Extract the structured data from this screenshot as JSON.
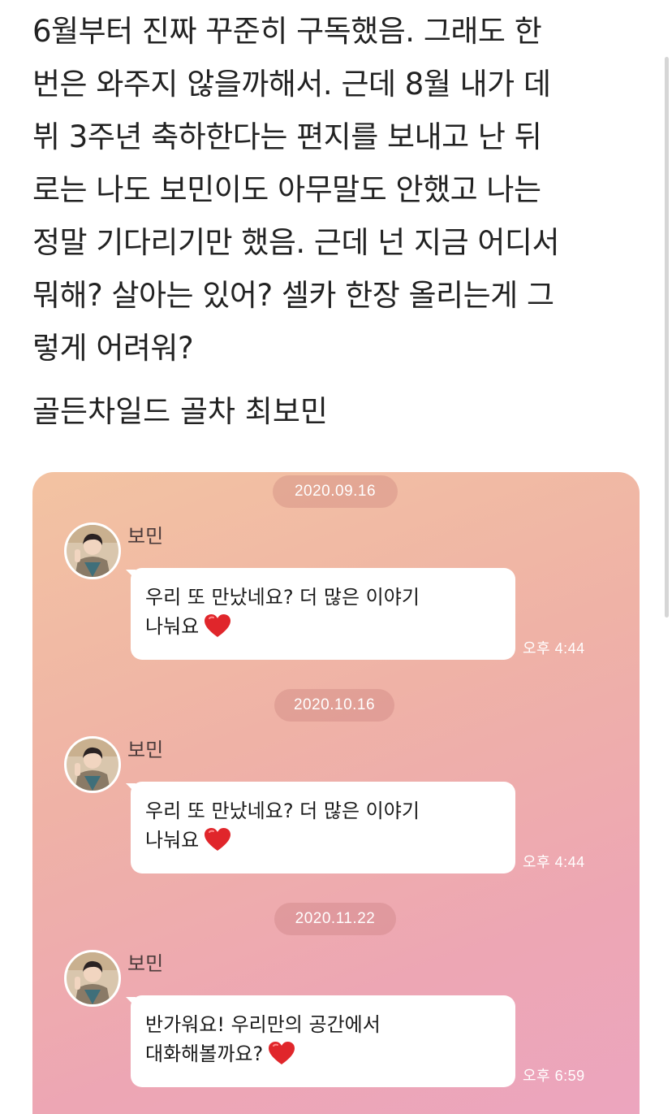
{
  "post": {
    "body": "6월부터 진짜 꾸준히 구독했음. 그래도 한\n번은 와주지 않을까해서. 근데 8월 내가 데\n뷔 3주년 축하한다는 편지를 보내고 난 뒤\n로는 나도 보민이도 아무말도 안했고 나는\n정말 기다리기만 했음. 근데 넌 지금 어디서\n뭐해? 살아는 있어? 셀카 한장 올리는게 그\n렇게 어려워?",
    "signature": "골든차일드 골차 최보민"
  },
  "chat": {
    "messages": [
      {
        "date": "2020.09.16",
        "sender": "보민",
        "line1": "우리 또 만났네요? 더 많은 이야기",
        "line2": "나눠요",
        "time": "오후 4:44",
        "emoji": "heart-icon"
      },
      {
        "date": "2020.10.16",
        "sender": "보민",
        "line1": "우리 또 만났네요? 더 많은 이야기",
        "line2": "나눠요",
        "time": "오후 4:44",
        "emoji": "heart-icon"
      },
      {
        "date": "2020.11.22",
        "sender": "보민",
        "line1": "반가워요! 우리만의 공간에서",
        "line2": "대화해볼까요?",
        "time": "오후 6:59",
        "emoji": "heart-icon"
      }
    ]
  },
  "colors": {
    "heart": "#e0262b",
    "card_top": "#f3c3a2",
    "card_bottom": "#eca5be"
  }
}
